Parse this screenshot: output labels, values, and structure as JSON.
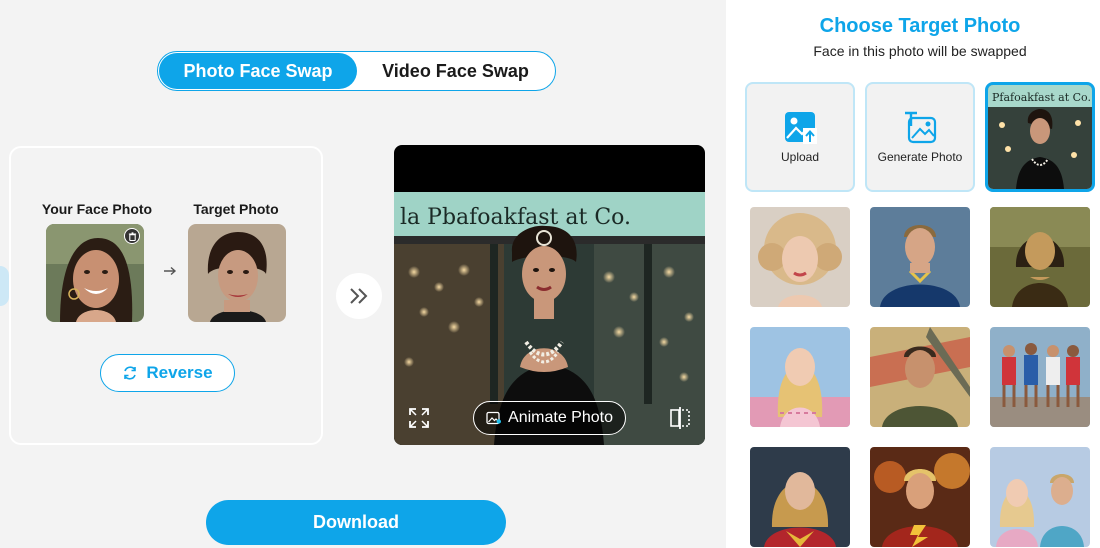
{
  "mode_toggle": {
    "photo_label": "Photo Face Swap",
    "video_label": "Video Face Swap"
  },
  "source": {
    "your_face_label": "Your Face Photo",
    "target_label": "Target Photo",
    "reverse_label": "Reverse"
  },
  "result": {
    "sign_text": "la Pbafoakfast at Co.",
    "animate_label": "Animate Photo"
  },
  "download_label": "Download",
  "panel": {
    "title": "Choose Target Photo",
    "subtitle": "Face in this photo will be swapped",
    "upload_label": "Upload",
    "generate_label": "Generate Photo",
    "selected_sign_text": "Pfafoakfast at Co."
  },
  "colors": {
    "accent": "#0ea5e9",
    "background": "#f3f3f3",
    "panel": "#ffffff"
  },
  "icons": [
    "trash-icon",
    "arrow-right-icon",
    "reverse-icon",
    "double-chevron-right-icon",
    "expand-icon",
    "image-sparkle-icon",
    "compare-icon",
    "upload-image-icon",
    "generate-text-image-icon"
  ]
}
